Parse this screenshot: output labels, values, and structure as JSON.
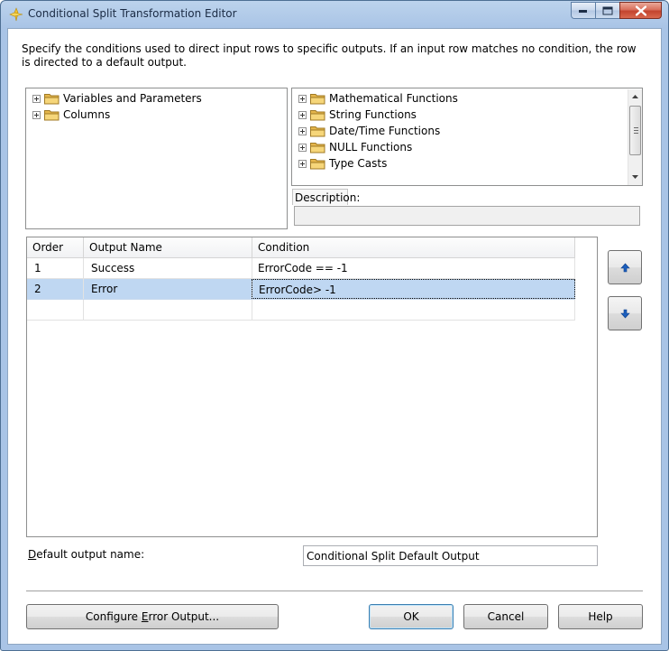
{
  "window": {
    "title": "Conditional Split Transformation Editor",
    "buttons": {
      "minimize": "minimize-icon",
      "maximize": "maximize-icon",
      "close": "close-icon"
    }
  },
  "instructions": "Specify the conditions used to direct input rows to specific outputs. If an input row matches no condition, the row is directed to a default output.",
  "left_tree": {
    "items": [
      {
        "label": "Variables and Parameters",
        "icon": "folder-icon"
      },
      {
        "label": "Columns",
        "icon": "folder-icon"
      }
    ]
  },
  "right_tree": {
    "items": [
      {
        "label": "Mathematical Functions",
        "icon": "folder-icon"
      },
      {
        "label": "String Functions",
        "icon": "folder-icon"
      },
      {
        "label": "Date/Time Functions",
        "icon": "folder-icon"
      },
      {
        "label": "NULL Functions",
        "icon": "folder-icon"
      },
      {
        "label": "Type Casts",
        "icon": "folder-icon"
      }
    ]
  },
  "description": {
    "label": "Description:",
    "value": ""
  },
  "grid": {
    "columns": [
      "Order",
      "Output Name",
      "Condition"
    ],
    "rows": [
      {
        "order": "1",
        "output_name": "Success",
        "condition": "ErrorCode == -1",
        "selected": false
      },
      {
        "order": "2",
        "output_name": "Error",
        "condition": "ErrorCode> -1",
        "selected": true
      },
      {
        "order": "",
        "output_name": "",
        "condition": "",
        "selected": false
      }
    ]
  },
  "move_up_icon": "arrow-up-icon",
  "move_down_icon": "arrow-down-icon",
  "default_output": {
    "label_prefix": "D",
    "label_rest": "efault output name:",
    "value": "Conditional Split Default Output"
  },
  "buttons": {
    "configure_prefix": "Configure ",
    "configure_mnemonic": "E",
    "configure_rest": "rror Output...",
    "ok": "OK",
    "cancel": "Cancel",
    "help": "Help"
  },
  "colors": {
    "selection": "#bfd7f2",
    "title_bar": "#a9c4e6",
    "close_button": "#c3442e",
    "arrow_blue": "#1c5fbd"
  }
}
